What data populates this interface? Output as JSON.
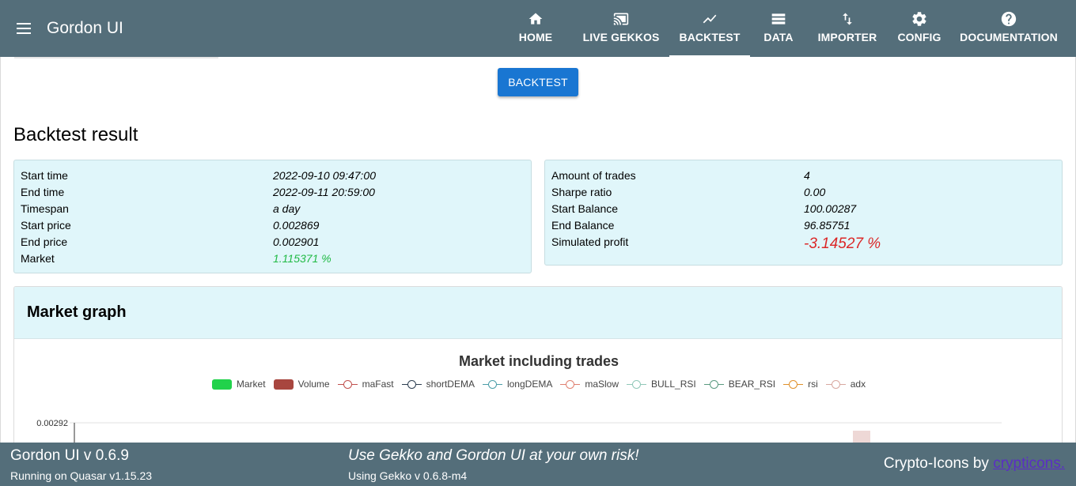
{
  "header": {
    "title": "Gordon UI",
    "nav": [
      {
        "label": "HOME",
        "icon": "home-icon"
      },
      {
        "label": "LIVE GEKKOS",
        "icon": "cast-icon"
      },
      {
        "label": "BACKTEST",
        "icon": "show-chart-icon",
        "active": true
      },
      {
        "label": "DATA",
        "icon": "storage-icon"
      },
      {
        "label": "IMPORTER",
        "icon": "import-export-icon"
      },
      {
        "label": "CONFIG",
        "icon": "gear-icon"
      },
      {
        "label": "DOCUMENTATION",
        "icon": "help-icon"
      }
    ]
  },
  "actions": {
    "backtest_label": "BACKTEST"
  },
  "result": {
    "title": "Backtest result",
    "left": [
      {
        "label": "Start time",
        "value": "2022-09-10 09:47:00"
      },
      {
        "label": "End time",
        "value": "2022-09-11 20:59:00"
      },
      {
        "label": "Timespan",
        "value": "a day"
      },
      {
        "label": "Start price",
        "value": "0.002869"
      },
      {
        "label": "End price",
        "value": "0.002901"
      },
      {
        "label": "Market",
        "value": "1.115371 %"
      }
    ],
    "right": [
      {
        "label": "Amount of trades",
        "value": "4"
      },
      {
        "label": "Sharpe ratio",
        "value": "0.00"
      },
      {
        "label": "Start Balance",
        "value": "100.00287"
      },
      {
        "label": "End Balance",
        "value": "96.85751"
      },
      {
        "label": "Simulated profit",
        "value": "-3.14527 %"
      }
    ],
    "colors": {
      "positive": "#21ba45",
      "negative": "#db2828"
    }
  },
  "graph": {
    "title": "Market graph",
    "chart_title": "Market including trades",
    "legend": [
      {
        "name": "Market",
        "kind": "box",
        "color": "#21d24b"
      },
      {
        "name": "Volume",
        "kind": "box",
        "color": "#a8463f"
      },
      {
        "name": "maFast",
        "kind": "line",
        "color": "#c0504d"
      },
      {
        "name": "shortDEMA",
        "kind": "line",
        "color": "#2c3e50"
      },
      {
        "name": "longDEMA",
        "kind": "line",
        "color": "#4a9da8"
      },
      {
        "name": "maSlow",
        "kind": "line",
        "color": "#e08070"
      },
      {
        "name": "BULL_RSI",
        "kind": "line",
        "color": "#90c8b8"
      },
      {
        "name": "BEAR_RSI",
        "kind": "line",
        "color": "#5a9a80"
      },
      {
        "name": "rsi",
        "kind": "line",
        "color": "#e0902a"
      },
      {
        "name": "adx",
        "kind": "line",
        "color": "#d8a8a0"
      }
    ],
    "y_tick_top": "0.00292"
  },
  "footer": {
    "version": "Gordon UI v 0.6.9",
    "quasar": "Running on Quasar v1.15.23",
    "risk": "Use Gekko and Gordon UI at your own risk!",
    "gekko": "Using Gekko v 0.6.8-m4",
    "credit_prefix": "Crypto-Icons by ",
    "credit_link": "crypticons."
  }
}
